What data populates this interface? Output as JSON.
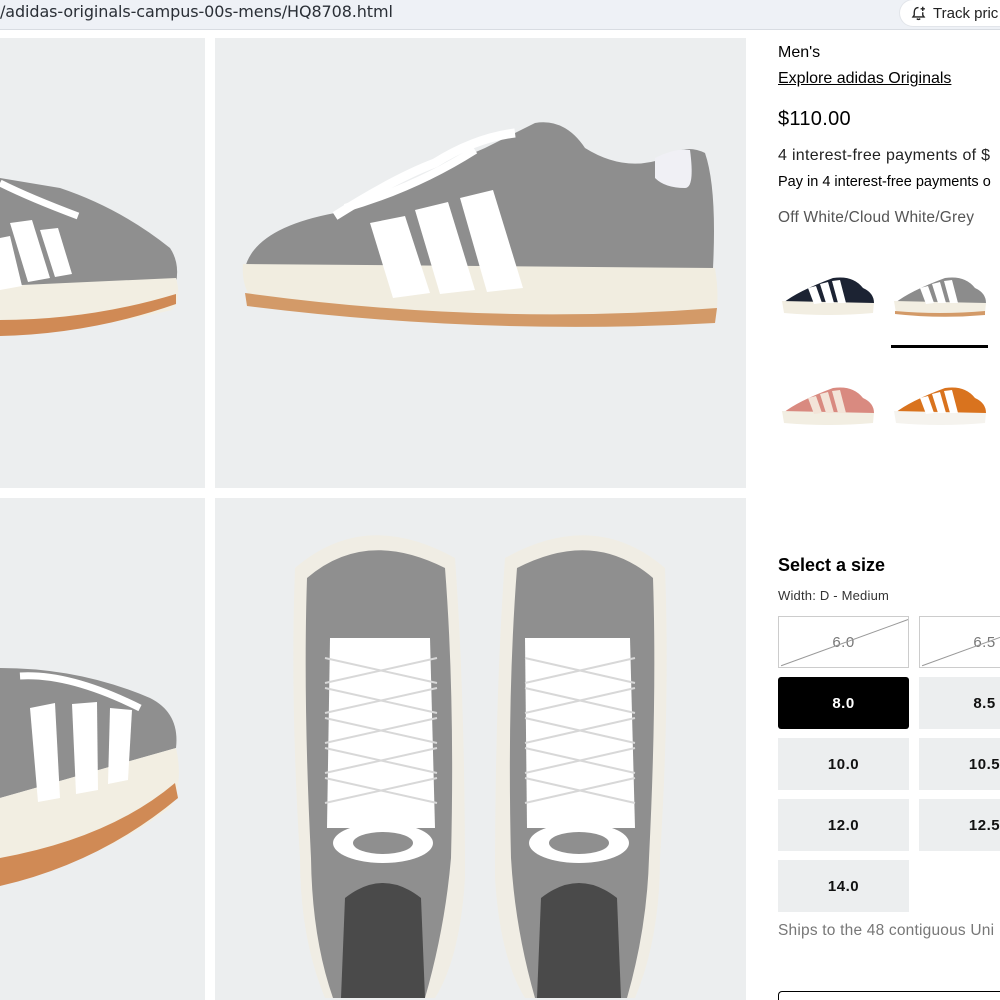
{
  "address_bar": {
    "url": "/adidas-originals-campus-00s-mens/HQ8708.html",
    "track_price_label": "Track pric"
  },
  "gallery": {
    "images": [
      {
        "name": "shoe-side-view-left"
      },
      {
        "name": "shoe-side-view"
      },
      {
        "name": "shoe-back-view"
      },
      {
        "name": "shoe-top-view"
      }
    ]
  },
  "product": {
    "gender": "Men's",
    "explore_link": "Explore adidas Originals",
    "price": "$110.00",
    "interest_text": "4 interest-free payments of $",
    "pay_in_text": "Pay in 4 interest-free payments o",
    "colorway": "Off White/Cloud White/Grey",
    "swatches": [
      {
        "name": "black",
        "color": "#1c2333"
      },
      {
        "name": "grey",
        "color": "#8c8c8c",
        "selected": true
      },
      {
        "name": "pink",
        "color": "#d98a80"
      },
      {
        "name": "orange",
        "color": "#d9731e"
      }
    ]
  },
  "sizes": {
    "title": "Select a size",
    "width_label": "Width: D - Medium",
    "options": [
      {
        "label": "6.0",
        "status": "unavailable"
      },
      {
        "label": "6.5",
        "status": "unavailable"
      },
      {
        "label": "8.0",
        "status": "selected"
      },
      {
        "label": "8.5",
        "status": "available"
      },
      {
        "label": "10.0",
        "status": "available"
      },
      {
        "label": "10.5",
        "status": "available"
      },
      {
        "label": "12.0",
        "status": "available"
      },
      {
        "label": "12.5",
        "status": "available"
      },
      {
        "label": "14.0",
        "status": "available"
      }
    ]
  },
  "shipping": {
    "text": "Ships to the 48 contiguous Uni"
  }
}
